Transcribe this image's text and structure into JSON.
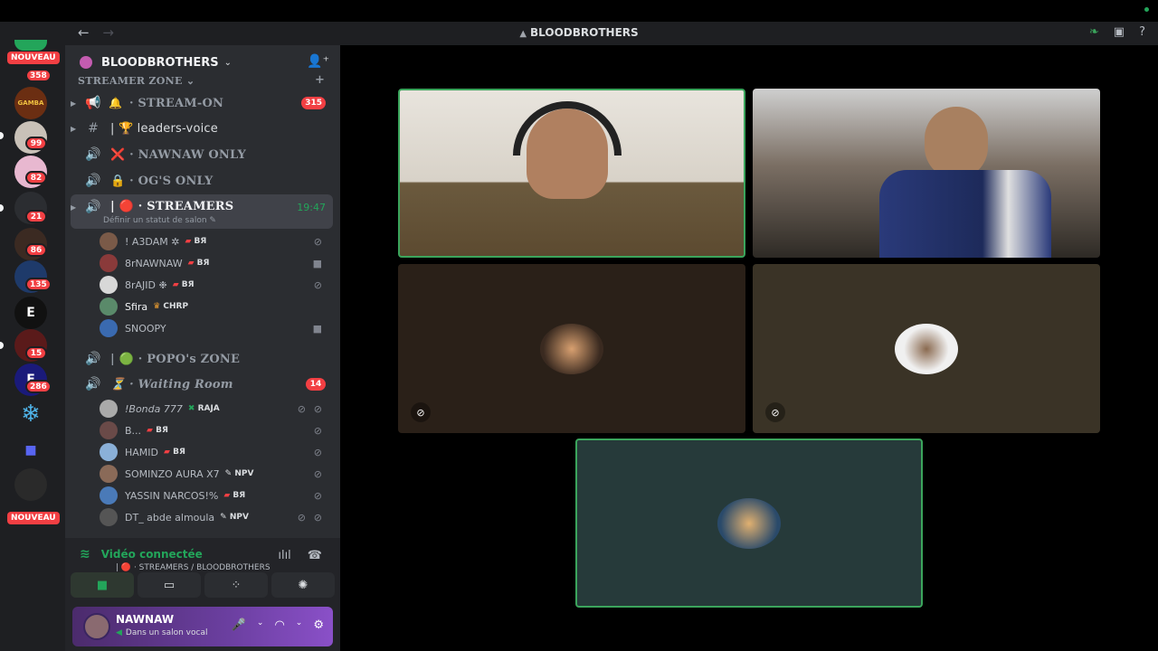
{
  "window": {
    "title": "BLOODBROTHERS",
    "back_icon": "←",
    "forward_icon": "→"
  },
  "servers": {
    "nouveau_label": "NOUVEAU",
    "badges": [
      "358",
      "99",
      "82",
      "21",
      "86",
      "135",
      "15",
      "286"
    ],
    "gamba_label": "GAMBA",
    "icon_glyphs": {
      "e": "E",
      "f": "F",
      "snow": "❄"
    }
  },
  "guild": {
    "name": "BLOODBROTHERS",
    "category": "STREAMER ZONE",
    "channels": [
      {
        "name": "STREAM-ON",
        "prefix": "·",
        "emoji": "🔔",
        "count": "315"
      },
      {
        "name": "leaders-voice",
        "prefix": "|",
        "emoji": "🏆"
      },
      {
        "name": "NAWNAW ONLY",
        "prefix": "·",
        "emoji": "❌"
      },
      {
        "name": "OG'S ONLY",
        "prefix": "·",
        "emoji": "🔒"
      },
      {
        "name": "STREAMERS",
        "prefix": "| 🔴 ·",
        "time": "19:47",
        "status": "Définir un statut de salon"
      },
      {
        "name": "POPO's ZONE",
        "prefix": "| 🟢 ·"
      },
      {
        "name": "Waiting Room",
        "prefix": "·",
        "emoji": "⏳",
        "count": "14"
      }
    ],
    "streamers": [
      {
        "name": "! A3DAM ✲",
        "tag": "ВЯ"
      },
      {
        "name": "8rNAWNAW",
        "tag": "ВЯ"
      },
      {
        "name": "8rAJID ❉",
        "tag": "ВЯ"
      },
      {
        "name": "Sfira",
        "tag": "CHRP"
      },
      {
        "name": "SNOOPY",
        "tag": ""
      }
    ],
    "waiting": [
      {
        "name": "!Bonda 777",
        "tag": "RAJA"
      },
      {
        "name": "B...",
        "tag": "ВЯ"
      },
      {
        "name": "HAMID",
        "tag": "ВЯ"
      },
      {
        "name": "SOMINZO AURA X7",
        "tag": "NPV"
      },
      {
        "name": "YASSIN NARCOS!%",
        "tag": "ВЯ"
      },
      {
        "name": "DT_ abde almoula",
        "tag": "NPV"
      }
    ]
  },
  "voice_panel": {
    "status": "Vidéo connectée",
    "channel_path": "| 🔴 · STREAMERS / BLOODBROTHERS"
  },
  "user": {
    "name": "NAWNAW",
    "status": "Dans un salon vocal"
  },
  "colors": {
    "accent_green": "#23a55a",
    "badge_red": "#f23f43",
    "speaking_border": "#3ba55c"
  }
}
